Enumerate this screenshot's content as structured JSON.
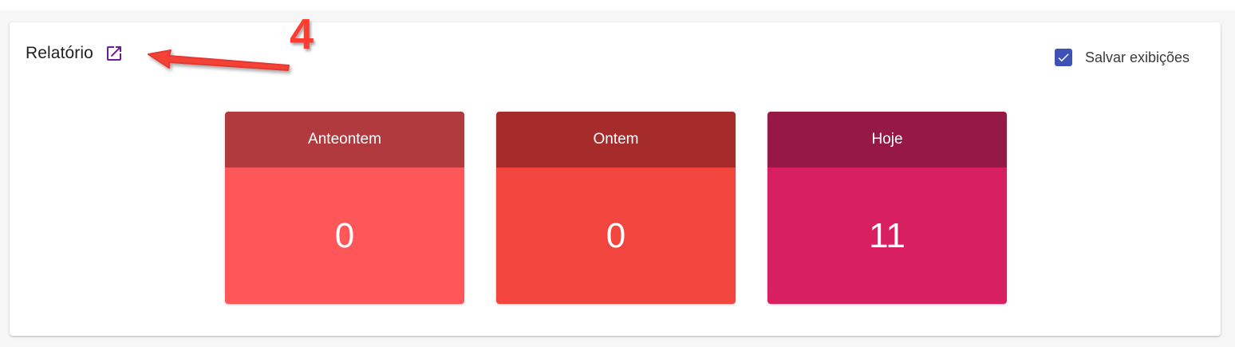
{
  "report": {
    "title": "Relatório",
    "open_icon": "open-in-new-icon",
    "save_views": {
      "label": "Salvar exibições",
      "checked": true,
      "icon": "check-icon"
    }
  },
  "stats": [
    {
      "label": "Anteontem",
      "value": "0",
      "header_color": "#b03a3e",
      "body_color": "#fe5659"
    },
    {
      "label": "Ontem",
      "value": "0",
      "header_color": "#a62c2c",
      "body_color": "#f2453d"
    },
    {
      "label": "Hoje",
      "value": "11",
      "header_color": "#951845",
      "body_color": "#d81f60"
    }
  ],
  "annotation": {
    "number": "4",
    "color": "#ff3b30"
  },
  "colors": {
    "accent": "#3f51b5",
    "link_icon": "#6a1b9a"
  }
}
